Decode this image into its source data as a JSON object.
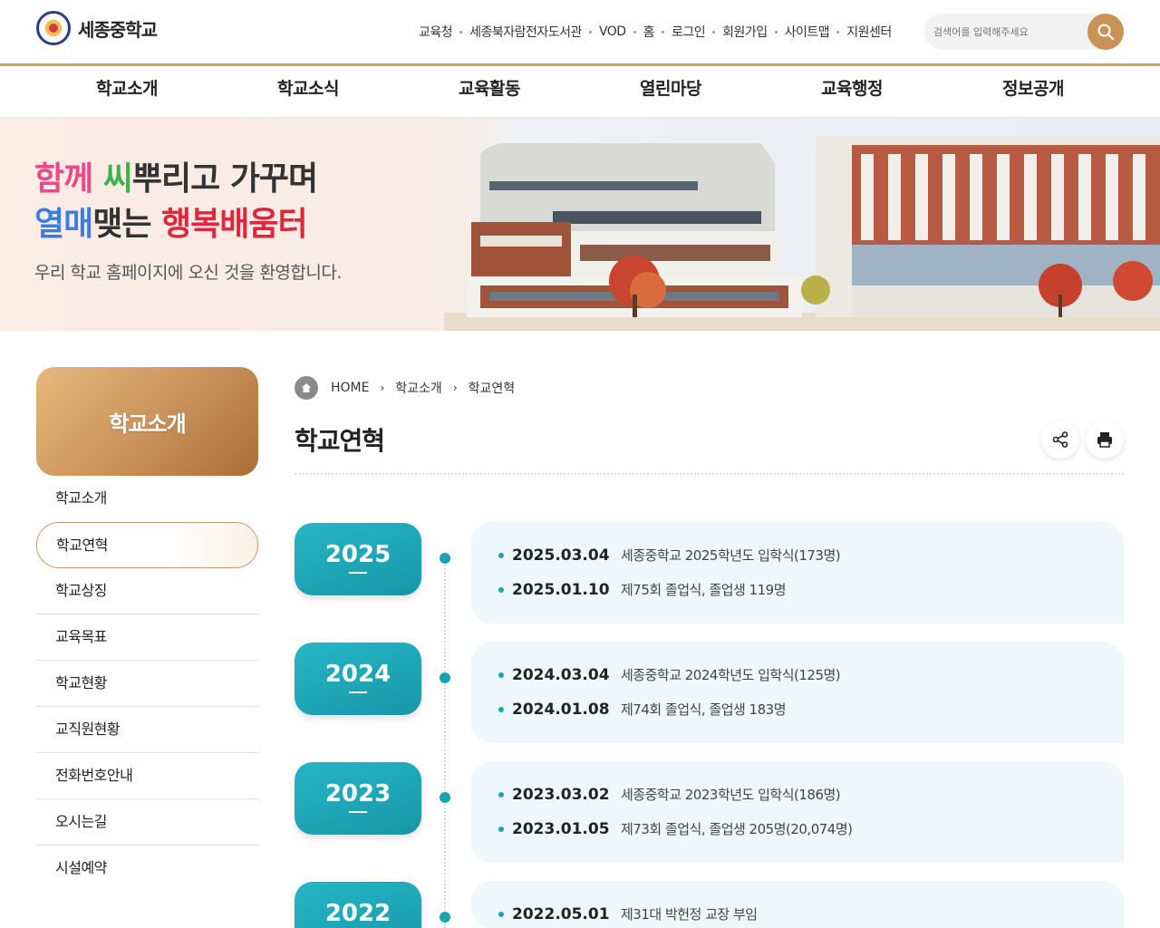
{
  "header": {
    "logo_text": "세종중학교",
    "util_links": [
      "교육청",
      "세종북자람전자도서관",
      "VOD",
      "홈",
      "로그인",
      "회원가입",
      "사이트맵",
      "지원센터"
    ],
    "search_placeholder": "검색어를 입력해주세요"
  },
  "gnb": [
    "학교소개",
    "학교소식",
    "교육활동",
    "열린마당",
    "교육행정",
    "정보공개"
  ],
  "banner": {
    "line1": {
      "a": "함께",
      "b": "씨",
      "c": "뿌리고 가꾸며"
    },
    "line2": {
      "a": "열매",
      "b": "맺는",
      "c": "행복배움터"
    },
    "welcome": "우리 학교 홈페이지에 오신 것을 환영합니다."
  },
  "lnb": {
    "title": "학교소개",
    "items": [
      "학교소개",
      "학교연혁",
      "학교상징",
      "교육목표",
      "학교현황",
      "교직원현황",
      "전화번호안내",
      "오시는길",
      "시설예약"
    ],
    "active_index": 1
  },
  "breadcrumb": [
    "HOME",
    "학교소개",
    "학교연혁"
  ],
  "page_title": "학교연혁",
  "timeline": [
    {
      "year": "2025",
      "events": [
        {
          "date": "2025.03.04",
          "desc": "세종중학교 2025학년도 입학식(173명)"
        },
        {
          "date": "2025.01.10",
          "desc": "제75회 졸업식, 졸업생 119명"
        }
      ]
    },
    {
      "year": "2024",
      "events": [
        {
          "date": "2024.03.04",
          "desc": "세종중학교 2024학년도 입학식(125명)"
        },
        {
          "date": "2024.01.08",
          "desc": "제74회 졸업식, 졸업생 183명"
        }
      ]
    },
    {
      "year": "2023",
      "events": [
        {
          "date": "2023.03.02",
          "desc": "세종중학교 2023학년도 입학식(186명)"
        },
        {
          "date": "2023.01.05",
          "desc": "제73회 졸업식, 졸업생 205명(20,074명)"
        }
      ]
    },
    {
      "year": "2022",
      "events": [
        {
          "date": "2022.05.01",
          "desc": "제31대 박헌정 교장 부임"
        }
      ]
    }
  ]
}
